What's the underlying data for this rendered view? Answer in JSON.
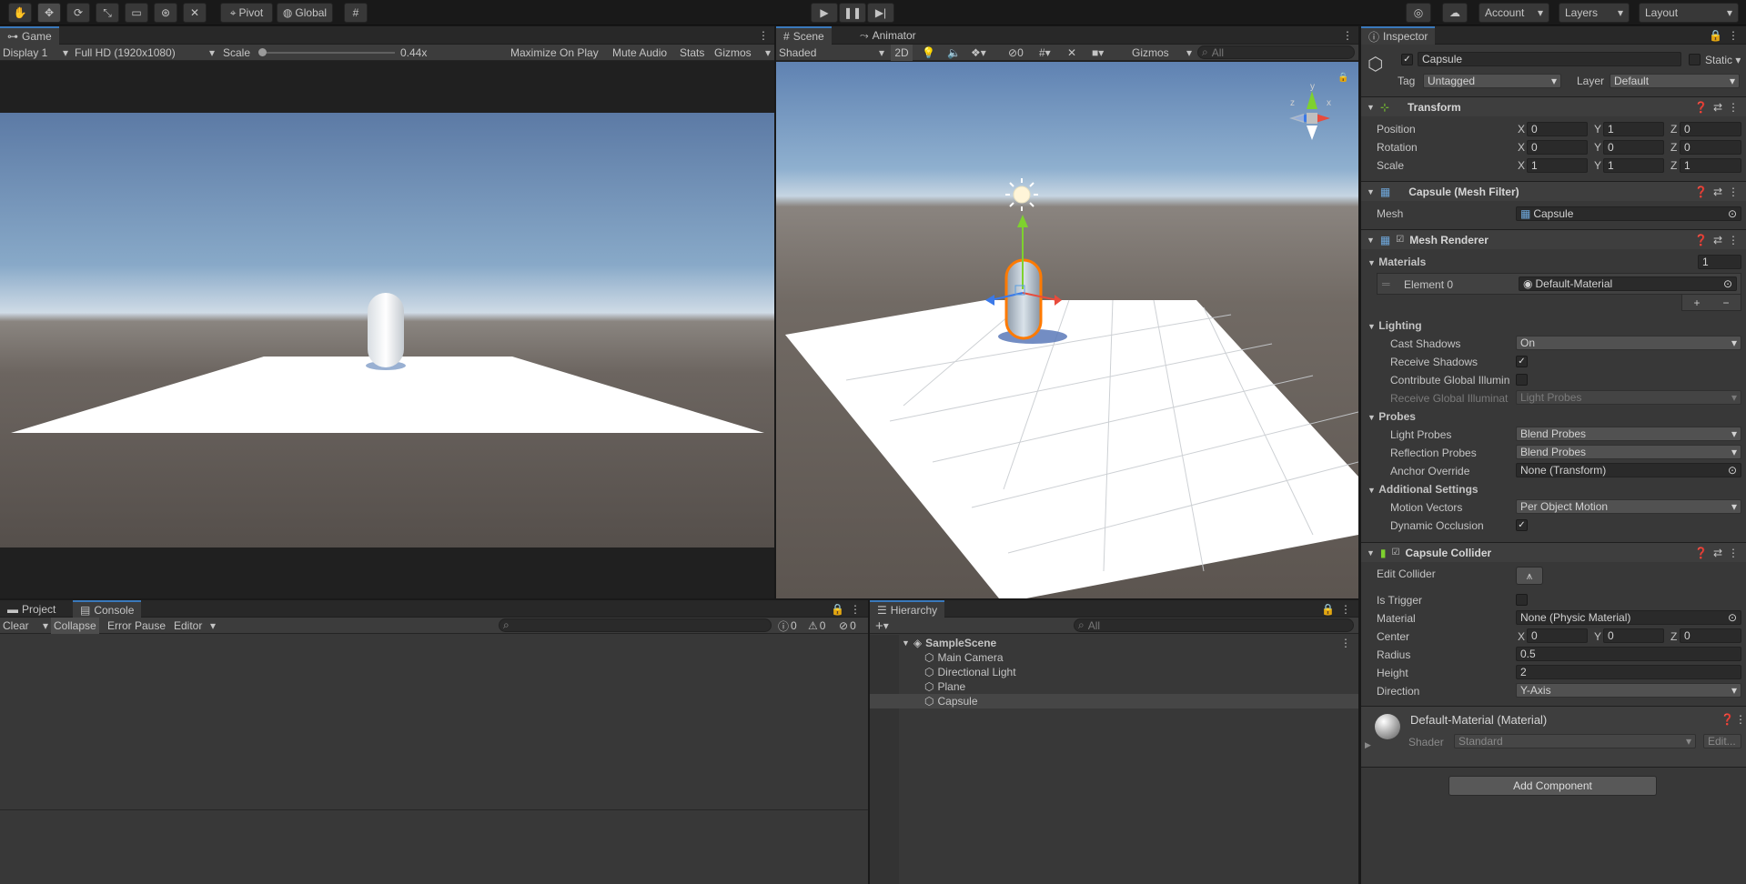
{
  "toolbar": {
    "pivot": "Pivot",
    "global": "Global",
    "account": "Account",
    "layers": "Layers",
    "layout": "Layout"
  },
  "game": {
    "tab": "Game",
    "display": "Display 1",
    "resolution": "Full HD (1920x1080)",
    "scale_label": "Scale",
    "scale_value": "0.44x",
    "maximize": "Maximize On Play",
    "mute": "Mute Audio",
    "stats": "Stats",
    "gizmos": "Gizmos"
  },
  "scene": {
    "tab": "Scene",
    "animator_tab": "Animator",
    "shading": "Shaded",
    "mode_2d": "2D",
    "hidden_count": "0",
    "gizmos": "Gizmos",
    "search_placeholder": "All",
    "axis_y": "y",
    "axis_x": "x",
    "axis_z": "z"
  },
  "bottom": {
    "project_tab": "Project",
    "console_tab": "Console",
    "clear": "Clear",
    "collapse": "Collapse",
    "error_pause": "Error Pause",
    "editor": "Editor",
    "log_count": "0",
    "warn_count": "0",
    "err_count": "0"
  },
  "hierarchy": {
    "tab": "Hierarchy",
    "search_placeholder": "All",
    "scene": "SampleScene",
    "items": [
      "Main Camera",
      "Directional Light",
      "Plane",
      "Capsule"
    ]
  },
  "inspector": {
    "tab": "Inspector",
    "object_name": "Capsule",
    "static": "Static",
    "tag_label": "Tag",
    "tag": "Untagged",
    "layer_label": "Layer",
    "layer": "Default",
    "transform": {
      "title": "Transform",
      "rows": [
        {
          "label": "Position",
          "x": "0",
          "y": "1",
          "z": "0"
        },
        {
          "label": "Rotation",
          "x": "0",
          "y": "0",
          "z": "0"
        },
        {
          "label": "Scale",
          "x": "1",
          "y": "1",
          "z": "1"
        }
      ]
    },
    "mesh_filter": {
      "title": "Capsule (Mesh Filter)",
      "mesh_label": "Mesh",
      "mesh": "Capsule"
    },
    "mesh_renderer": {
      "title": "Mesh Renderer",
      "materials_label": "Materials",
      "materials_count": "1",
      "element_label": "Element 0",
      "element_value": "Default-Material",
      "lighting_label": "Lighting",
      "cast_shadows_label": "Cast Shadows",
      "cast_shadows": "On",
      "receive_shadows_label": "Receive Shadows",
      "contribute_gi_label": "Contribute Global Illumin",
      "receive_gi_label": "Receive Global Illuminat",
      "receive_gi": "Light Probes",
      "probes_label": "Probes",
      "light_probes_label": "Light Probes",
      "light_probes": "Blend Probes",
      "reflection_probes_label": "Reflection Probes",
      "reflection_probes": "Blend Probes",
      "anchor_label": "Anchor Override",
      "anchor": "None (Transform)",
      "additional_label": "Additional Settings",
      "motion_vectors_label": "Motion Vectors",
      "motion_vectors": "Per Object Motion",
      "dynamic_occlusion_label": "Dynamic Occlusion"
    },
    "collider": {
      "title": "Capsule Collider",
      "edit_label": "Edit Collider",
      "is_trigger_label": "Is Trigger",
      "material_label": "Material",
      "material": "None (Physic Material)",
      "center_label": "Center",
      "cx": "0",
      "cy": "0",
      "cz": "0",
      "radius_label": "Radius",
      "radius": "0.5",
      "height_label": "Height",
      "height": "2",
      "direction_label": "Direction",
      "direction": "Y-Axis"
    },
    "material": {
      "title": "Default-Material (Material)",
      "shader_label": "Shader",
      "shader": "Standard",
      "edit": "Edit..."
    },
    "add_component": "Add Component",
    "axis_x": "X",
    "axis_y": "Y",
    "axis_z": "Z"
  },
  "colors": {
    "accent": "#3a79bb",
    "selection": "#ff7a00"
  }
}
